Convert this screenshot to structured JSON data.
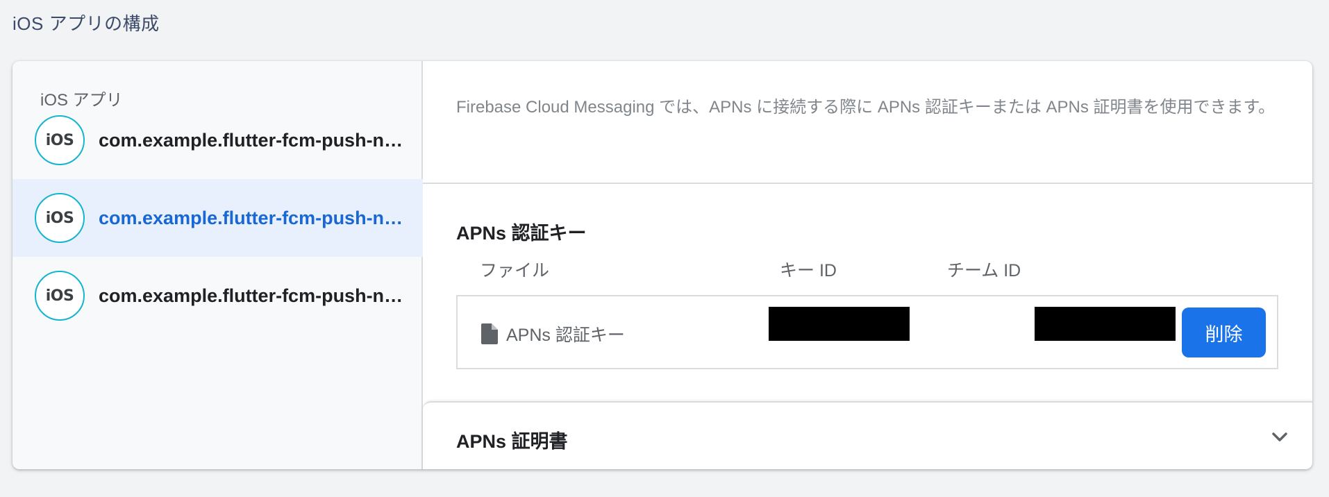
{
  "page": {
    "section_title": "iOS アプリの構成"
  },
  "sidebar": {
    "heading": "iOS アプリ",
    "apps": [
      {
        "badge": "iOS",
        "name": "com.example.flutter-fcm-push-notification",
        "selected": false
      },
      {
        "badge": "iOS",
        "name": "com.example.flutter-fcm-push-notification",
        "selected": true
      },
      {
        "badge": "iOS",
        "name": "com.example.flutter-fcm-push-notification",
        "selected": false
      }
    ]
  },
  "main": {
    "description": "Firebase Cloud Messaging では、APNs に接続する際に APNs 認証キーまたは APNs 証明書を使用できます。",
    "auth_key": {
      "title": "APNs 認証キー",
      "columns": {
        "file": "ファイル",
        "key_id": "キー ID",
        "team_id": "チーム ID"
      },
      "row": {
        "file_name": "APNs 認証キー",
        "key_id": "",
        "team_id": ""
      },
      "delete_label": "削除"
    },
    "certificate": {
      "title": "APNs 証明書"
    }
  },
  "icons": {
    "file": "file-icon",
    "chevron": "chevron-down-icon"
  },
  "colors": {
    "accent": "#1a73e8",
    "selected_bg": "#e8f0fe",
    "ios_ring": "#12b5cb",
    "selected_text": "#1967d2"
  }
}
